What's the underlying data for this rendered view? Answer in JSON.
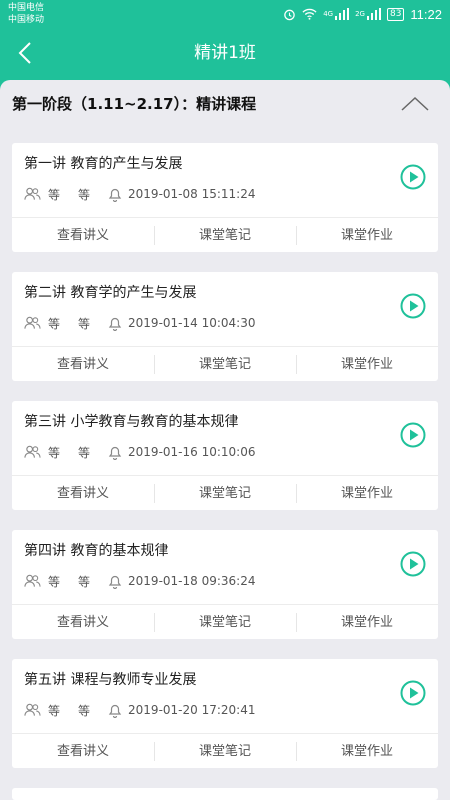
{
  "status": {
    "carrier1": "中国电信",
    "carrier2": "中国移动",
    "net1": "4G",
    "net2": "2G",
    "battery": "83",
    "time": "11:22"
  },
  "nav": {
    "title": "精讲1班"
  },
  "stage": {
    "title": "第一阶段（1.11~2.17）：精讲课程"
  },
  "actions": [
    "查看讲义",
    "课堂笔记",
    "课堂作业"
  ],
  "lessons": [
    {
      "title": "第一讲 教育的产生与发展",
      "tag1": "等",
      "tag2": "等",
      "time": "2019-01-08 15:11:24"
    },
    {
      "title": "第二讲 教育学的产生与发展",
      "tag1": "等",
      "tag2": "等",
      "time": "2019-01-14 10:04:30"
    },
    {
      "title": "第三讲 小学教育与教育的基本规律",
      "tag1": "等",
      "tag2": "等",
      "time": "2019-01-16 10:10:06"
    },
    {
      "title": "第四讲 教育的基本规律",
      "tag1": "等",
      "tag2": "等",
      "time": "2019-01-18 09:36:24"
    },
    {
      "title": "第五讲 课程与教师专业发展",
      "tag1": "等",
      "tag2": "等",
      "time": "2019-01-20 17:20:41"
    }
  ],
  "colors": {
    "accent": "#1fc19a",
    "background": "#ebebf0"
  }
}
